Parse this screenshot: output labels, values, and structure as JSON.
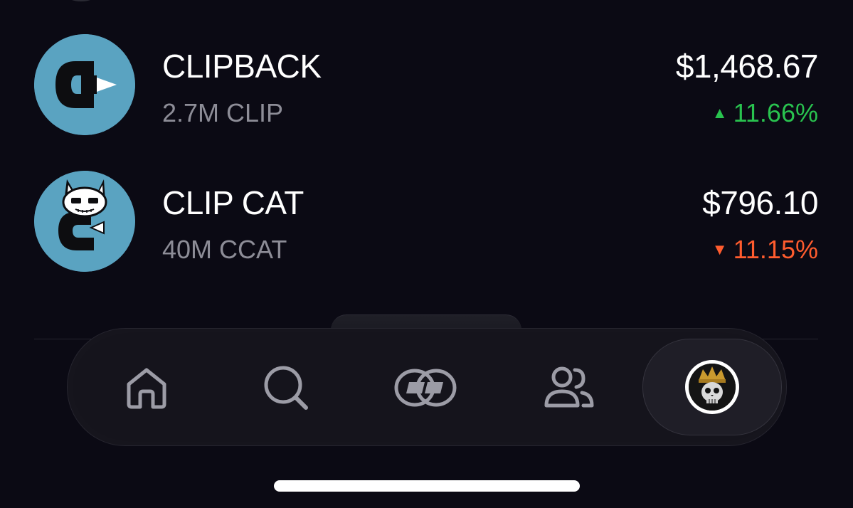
{
  "tokens": [
    {
      "name": "CLIPBACK",
      "amount": "2.7M CLIP",
      "value": "$1,468.67",
      "change": "11.66%",
      "direction": "up",
      "logo_icon": "clipback-logo-icon"
    },
    {
      "name": "CLIP CAT",
      "amount": "40M CCAT",
      "value": "$796.10",
      "change": "11.15%",
      "direction": "down",
      "logo_icon": "clipcat-logo-icon"
    }
  ],
  "nav": {
    "items": [
      "home-icon",
      "search-icon",
      "clip-icon",
      "people-icon",
      "profile-avatar"
    ]
  },
  "colors": {
    "background": "#0b0a14",
    "up": "#29c34f",
    "down": "#ff5c2e",
    "logo_bg": "#5aa3c1",
    "muted_text": "#8d8d97"
  }
}
